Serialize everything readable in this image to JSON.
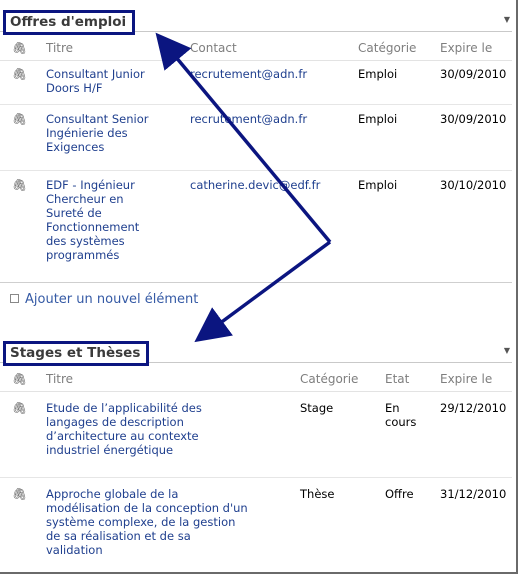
{
  "offres": {
    "title": "Offres d'emploi",
    "columns": {
      "titre": "Titre",
      "contact": "Contact",
      "categorie": "Catégorie",
      "expire": "Expire le"
    },
    "rows": [
      {
        "titre": [
          "Consultant Junior",
          "Doors H/F"
        ],
        "contact": "recrutement@adn.fr",
        "categorie": "Emploi",
        "expire": "30/09/2010"
      },
      {
        "titre": [
          "Consultant Senior",
          "Ingénierie des",
          "Exigences"
        ],
        "contact": "recrutement@adn.fr",
        "categorie": "Emploi",
        "expire": "30/09/2010"
      },
      {
        "titre": [
          "EDF - Ingénieur",
          "Chercheur en",
          "Sureté de",
          "Fonctionnement",
          "des systèmes",
          "programmés"
        ],
        "contact": "catherine.devic@edf.fr",
        "categorie": "Emploi",
        "expire": "30/10/2010"
      }
    ],
    "add_label": "Ajouter un nouvel élément"
  },
  "stages": {
    "title": "Stages et Thèses",
    "columns": {
      "titre": "Titre",
      "categorie": "Catégorie",
      "etat": "Etat",
      "expire": "Expire le"
    },
    "rows": [
      {
        "titre": [
          "Etude de l’applicabilité des",
          "langages de description",
          "d’architecture au contexte",
          "industriel énergétique"
        ],
        "categorie": "Stage",
        "etat": [
          "En",
          "cours"
        ],
        "expire": "29/12/2010"
      },
      {
        "titre": [
          "Approche globale de la",
          "modélisation de la conception d'un",
          "système complexe, de la gestion",
          "de sa réalisation et de sa",
          "validation"
        ],
        "categorie": "Thèse",
        "etat": [
          "Offre"
        ],
        "expire": "31/12/2010"
      }
    ]
  },
  "icons": {
    "attachment": "paperclip-icon",
    "menu": "chevron-down-icon",
    "add": "add-item-icon"
  },
  "colors": {
    "highlight_border": "#0b1580",
    "arrow": "#0b1580",
    "link": "#1f3f8e"
  }
}
